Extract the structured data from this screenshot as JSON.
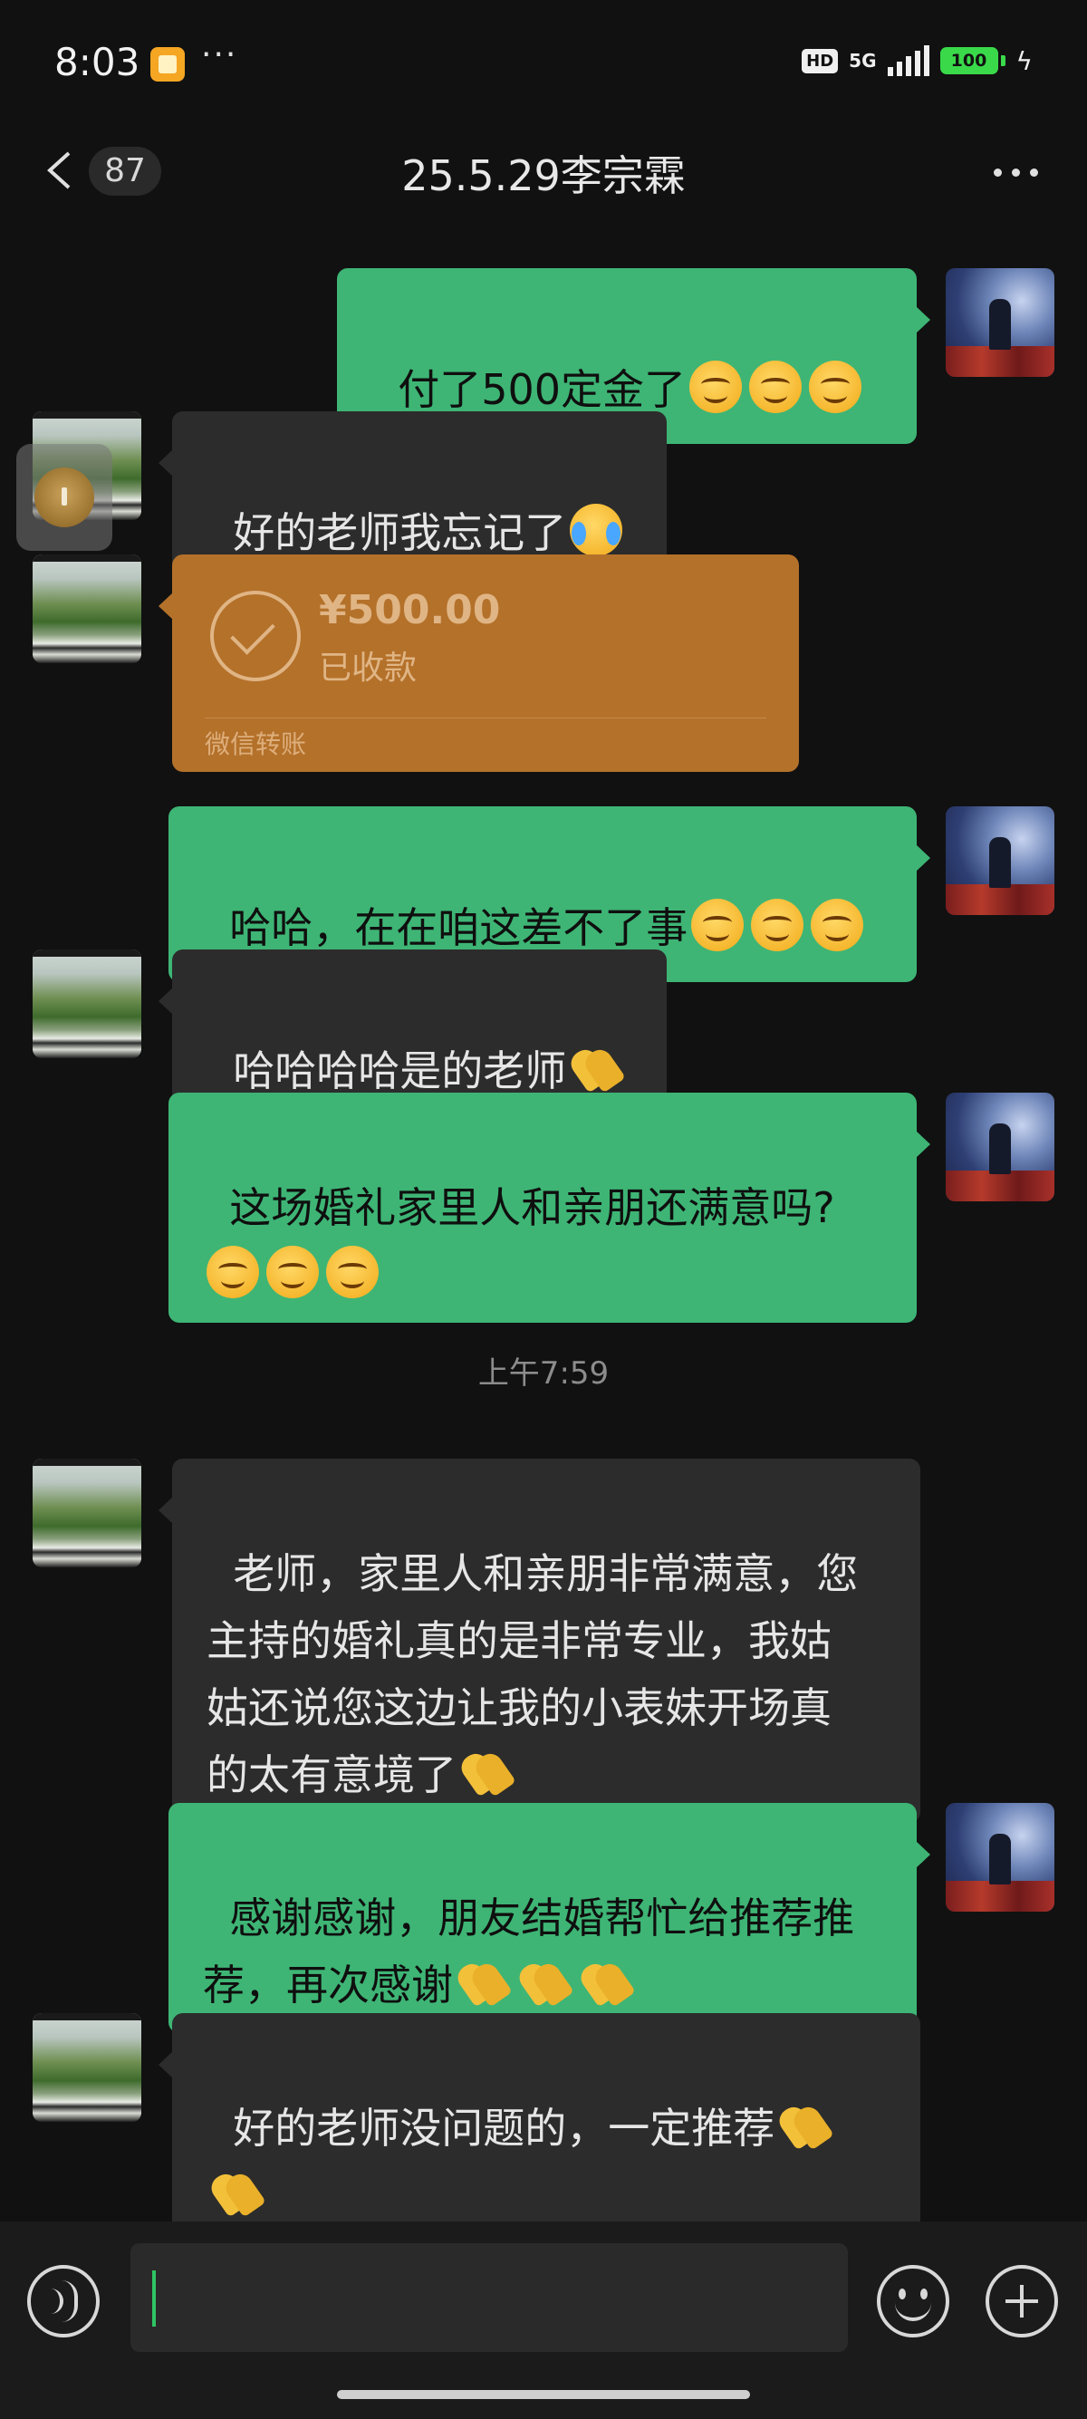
{
  "status_bar": {
    "time": "8:03",
    "more": "···",
    "hd": "HD",
    "network": "5G",
    "battery": "100"
  },
  "header": {
    "unread_count": "87",
    "title": "25.5.29李宗霖"
  },
  "messages": [
    {
      "text": "付了500定金了",
      "emoji": [
        "smile",
        "smile",
        "smile"
      ]
    },
    {
      "text": "好的老师我忘记了",
      "emoji": [
        "cry"
      ]
    },
    {
      "text": "哈哈，在在咱这差不了事",
      "emoji": [
        "smile",
        "smile",
        "smile"
      ]
    },
    {
      "text": "哈哈哈哈是的老师",
      "emoji": [
        "hands"
      ]
    },
    {
      "text": "这场婚礼家里人和亲朋还满意吗?",
      "emoji": [
        "smile",
        "smile",
        "smile"
      ]
    },
    {
      "text": "老师，家里人和亲朋非常满意，您\n主持的婚礼真的是非常专业，我姑\n姑还说您这边让我的小表妹开场真\n的太有意境了",
      "emoji": [
        "hands"
      ]
    },
    {
      "text": "感谢感谢，朋友结婚帮忙给推荐推\n荐，再次感谢",
      "emoji": [
        "hands",
        "hands",
        "hands"
      ]
    },
    {
      "text": "好的老师没问题的，一定推荐",
      "emoji": [
        "hands",
        "hands"
      ]
    }
  ],
  "transfer": {
    "amount": "¥500.00",
    "status": "已收款",
    "source": "微信转账"
  },
  "timestamp": "上午7:59",
  "icons": {
    "back": "chevron-left-icon",
    "more": "more-dots-icon",
    "voice": "voice-icon",
    "emoji": "emoji-icon",
    "plus": "plus-icon"
  },
  "colors": {
    "background": "#111111",
    "outgoing_bubble": "#3eb575",
    "incoming_bubble": "#2c2c2c",
    "transfer_card": "#b4712a"
  }
}
